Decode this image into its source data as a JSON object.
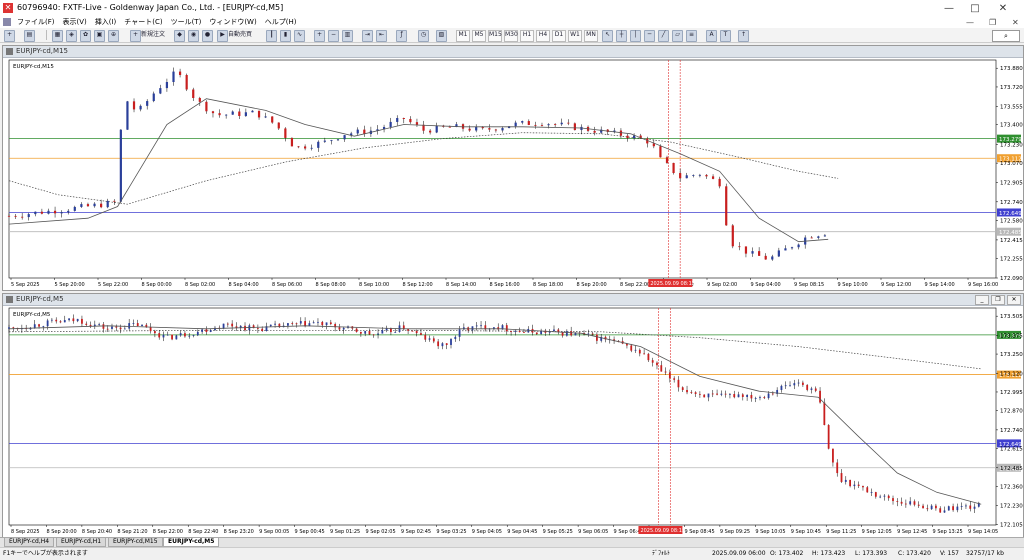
{
  "window": {
    "title": "60796940: FXTF-Live - Goldenway Japan Co., Ltd. - [EURJPY-cd,M5]",
    "icon": "metatrader-icon",
    "controls": [
      "—",
      "□",
      "✕"
    ]
  },
  "menu": {
    "items": [
      "ファイル(F)",
      "表示(V)",
      "挿入(I)",
      "チャート(C)",
      "ツール(T)",
      "ウィンドウ(W)",
      "ヘルプ(H)"
    ],
    "right_controls": [
      "—",
      "❐",
      "✕"
    ]
  },
  "toolbar": {
    "new_order": "新規注文",
    "auto_trade": "自動売買",
    "timeframes": [
      "M1",
      "M5",
      "M15",
      "M30",
      "H1",
      "H4",
      "D1",
      "W1",
      "MN"
    ],
    "search_icon": "magnifier-icon"
  },
  "colors": {
    "green_line": "#2f8f2f",
    "orange_line": "#f0a030",
    "blue_line": "#4040d0",
    "gray_line": "#b8b8b8",
    "red_vline": "#e03030",
    "bull": "#2a3f9a",
    "bear": "#c81e1e",
    "ma": "#555555"
  },
  "chart_top": {
    "window_title": "EURJPY-cd,M15",
    "symbol_label": "EURJPY-cd,M15",
    "price_labels": [
      "173.880",
      "173.720",
      "173.555",
      "173.400",
      "173.230",
      "173.070",
      "172.905",
      "172.740",
      "172.580",
      "172.415",
      "172.255",
      "172.090"
    ],
    "price_min": 172.09,
    "price_max": 173.95,
    "hlines": [
      {
        "price": 173.279,
        "label": "173.279",
        "color": "#2f8f2f"
      },
      {
        "price": 173.112,
        "label": "173.112",
        "color": "#f0a030"
      },
      {
        "price": 172.649,
        "label": "172.649",
        "color": "#4040d0"
      },
      {
        "price": 172.485,
        "label": "172.485",
        "color": "#b8b8b8"
      }
    ],
    "time_labels": [
      "5 Sep 2025",
      "5 Sep 20:00",
      "5 Sep 22:00",
      "8 Sep 00:00",
      "8 Sep 02:00",
      "8 Sep 04:00",
      "8 Sep 06:00",
      "8 Sep 08:00",
      "8 Sep 10:00",
      "8 Sep 12:00",
      "8 Sep 14:00",
      "8 Sep 16:00",
      "8 Sep 18:00",
      "8 Sep 20:00",
      "8 Sep 22:00",
      "9 Sep 00:00",
      "9 Sep 02:00",
      "9 Sep 04:00",
      "9 Sep 08:15",
      "9 Sep 10:00",
      "9 Sep 12:00",
      "9 Sep 14:00",
      "9 Sep 16:00"
    ],
    "cursor_time": "2025.09.09 08:15"
  },
  "chart_bottom": {
    "window_title": "EURJPY-cd,M5",
    "symbol_label": "EURJPY-cd,M5",
    "price_labels": [
      "173.505",
      "173.375",
      "173.250",
      "173.120",
      "172.995",
      "172.870",
      "172.740",
      "172.615",
      "172.485",
      "172.360",
      "172.230",
      "172.105"
    ],
    "price_min": 172.1,
    "price_max": 173.56,
    "hlines": [
      {
        "price": 173.379,
        "label": "173.379",
        "color": "#2f8f2f"
      },
      {
        "price": 173.112,
        "label": "173.112",
        "color": "#f0a030"
      },
      {
        "price": 172.649,
        "label": "172.649",
        "color": "#4040d0"
      },
      {
        "price": 172.485,
        "label": "172.485",
        "color": "#b8b8b8"
      }
    ],
    "time_labels": [
      "8 Sep 2025",
      "8 Sep 20:00",
      "8 Sep 20:40",
      "8 Sep 21:20",
      "8 Sep 22:00",
      "8 Sep 22:40",
      "8 Sep 23:20",
      "9 Sep 00:05",
      "9 Sep 00:45",
      "9 Sep 01:25",
      "9 Sep 02:05",
      "9 Sep 02:45",
      "9 Sep 03:25",
      "9 Sep 04:05",
      "9 Sep 04:45",
      "9 Sep 05:25",
      "9 Sep 06:05",
      "9 Sep 06:45",
      "9 Sep 08:05",
      "9 Sep 08:45",
      "9 Sep 09:25",
      "9 Sep 10:05",
      "9 Sep 10:45",
      "9 Sep 11:25",
      "9 Sep 12:05",
      "9 Sep 12:45",
      "9 Sep 13:25",
      "9 Sep 14:05"
    ],
    "cursor_time": "2025.09.09 08:15"
  },
  "chart_data": [
    {
      "type": "candlestick",
      "symbol": "EURJPY-cd",
      "timeframe": "M15",
      "ylim": [
        172.09,
        173.95
      ],
      "close_path": [
        [
          0,
          172.62
        ],
        [
          0.04,
          172.66
        ],
        [
          0.08,
          172.7
        ],
        [
          0.11,
          172.74
        ],
        [
          0.115,
          173.65
        ],
        [
          0.13,
          173.5
        ],
        [
          0.15,
          173.7
        ],
        [
          0.17,
          173.85
        ],
        [
          0.19,
          173.6
        ],
        [
          0.21,
          173.48
        ],
        [
          0.25,
          173.5
        ],
        [
          0.27,
          173.4
        ],
        [
          0.29,
          173.2
        ],
        [
          0.32,
          173.25
        ],
        [
          0.34,
          173.32
        ],
        [
          0.37,
          173.35
        ],
        [
          0.4,
          173.45
        ],
        [
          0.42,
          173.35
        ],
        [
          0.45,
          173.38
        ],
        [
          0.48,
          173.35
        ],
        [
          0.51,
          173.4
        ],
        [
          0.54,
          173.42
        ],
        [
          0.57,
          173.38
        ],
        [
          0.6,
          173.34
        ],
        [
          0.63,
          173.3
        ],
        [
          0.65,
          173.25
        ],
        [
          0.66,
          173.1
        ],
        [
          0.68,
          172.95
        ],
        [
          0.7,
          172.98
        ],
        [
          0.72,
          172.9
        ],
        [
          0.73,
          172.4
        ],
        [
          0.75,
          172.3
        ],
        [
          0.77,
          172.25
        ],
        [
          0.79,
          172.35
        ],
        [
          0.81,
          172.45
        ],
        [
          0.83,
          172.48
        ]
      ],
      "ma_fast": [
        [
          0,
          172.55
        ],
        [
          0.08,
          172.6
        ],
        [
          0.11,
          172.7
        ],
        [
          0.16,
          173.4
        ],
        [
          0.2,
          173.62
        ],
        [
          0.26,
          173.52
        ],
        [
          0.3,
          173.4
        ],
        [
          0.35,
          173.3
        ],
        [
          0.4,
          173.4
        ],
        [
          0.46,
          173.38
        ],
        [
          0.52,
          173.38
        ],
        [
          0.58,
          173.37
        ],
        [
          0.63,
          173.32
        ],
        [
          0.68,
          173.15
        ],
        [
          0.72,
          173.0
        ],
        [
          0.76,
          172.6
        ],
        [
          0.8,
          172.4
        ],
        [
          0.83,
          172.42
        ]
      ],
      "ma_slow": [
        [
          0,
          172.92
        ],
        [
          0.05,
          172.8
        ],
        [
          0.12,
          172.72
        ],
        [
          0.2,
          172.92
        ],
        [
          0.28,
          173.08
        ],
        [
          0.36,
          173.2
        ],
        [
          0.44,
          173.28
        ],
        [
          0.52,
          173.33
        ],
        [
          0.6,
          173.32
        ],
        [
          0.67,
          173.25
        ],
        [
          0.74,
          173.12
        ],
        [
          0.8,
          173.0
        ],
        [
          0.84,
          172.94
        ]
      ]
    },
    {
      "type": "candlestick",
      "symbol": "EURJPY-cd",
      "timeframe": "M5",
      "ylim": [
        172.1,
        173.56
      ],
      "close_path": [
        [
          0,
          173.42
        ],
        [
          0.04,
          173.46
        ],
        [
          0.07,
          173.48
        ],
        [
          0.1,
          173.42
        ],
        [
          0.13,
          173.45
        ],
        [
          0.16,
          173.36
        ],
        [
          0.19,
          173.4
        ],
        [
          0.22,
          173.45
        ],
        [
          0.25,
          173.42
        ],
        [
          0.28,
          173.44
        ],
        [
          0.31,
          173.46
        ],
        [
          0.34,
          173.42
        ],
        [
          0.37,
          173.38
        ],
        [
          0.4,
          173.43
        ],
        [
          0.42,
          173.36
        ],
        [
          0.44,
          173.3
        ],
        [
          0.46,
          173.42
        ],
        [
          0.49,
          173.44
        ],
        [
          0.52,
          173.4
        ],
        [
          0.55,
          173.4
        ],
        [
          0.58,
          173.38
        ],
        [
          0.61,
          173.34
        ],
        [
          0.64,
          173.26
        ],
        [
          0.66,
          173.14
        ],
        [
          0.68,
          173.02
        ],
        [
          0.7,
          172.98
        ],
        [
          0.72,
          172.96
        ],
        [
          0.74,
          172.98
        ],
        [
          0.76,
          172.96
        ],
        [
          0.78,
          173.02
        ],
        [
          0.8,
          173.06
        ],
        [
          0.82,
          172.98
        ],
        [
          0.83,
          172.62
        ],
        [
          0.84,
          172.42
        ],
        [
          0.86,
          172.36
        ],
        [
          0.88,
          172.3
        ],
        [
          0.9,
          172.26
        ],
        [
          0.92,
          172.24
        ],
        [
          0.94,
          172.2
        ],
        [
          0.96,
          172.22
        ],
        [
          0.985,
          172.23
        ]
      ],
      "ma_fast": [
        [
          0,
          173.42
        ],
        [
          0.1,
          173.44
        ],
        [
          0.2,
          173.42
        ],
        [
          0.3,
          173.44
        ],
        [
          0.4,
          173.42
        ],
        [
          0.5,
          173.42
        ],
        [
          0.58,
          173.39
        ],
        [
          0.64,
          173.3
        ],
        [
          0.7,
          173.1
        ],
        [
          0.76,
          173.0
        ],
        [
          0.82,
          172.96
        ],
        [
          0.86,
          172.7
        ],
        [
          0.9,
          172.45
        ],
        [
          0.94,
          172.32
        ],
        [
          0.985,
          172.24
        ]
      ],
      "ma_slow": [
        [
          0,
          173.4
        ],
        [
          0.2,
          173.41
        ],
        [
          0.4,
          173.41
        ],
        [
          0.6,
          173.4
        ],
        [
          0.7,
          173.36
        ],
        [
          0.8,
          173.3
        ],
        [
          0.9,
          173.22
        ],
        [
          0.985,
          173.15
        ]
      ]
    }
  ],
  "tabs": [
    "EURJPY-cd,H4",
    "EURJPY-cd,H1",
    "EURJPY-cd,M15",
    "EURJPY-cd,M5"
  ],
  "active_tab": 3,
  "status": {
    "help": "F1キーでヘルプが表示されます",
    "profile": "ﾃﾞﾌｫﾙﾄ",
    "datetime": "2025.09.09 06:00",
    "open": "O: 173.402",
    "high": "H: 173.423",
    "low": "L: 173.393",
    "close": "C: 173.420",
    "volume": "V: 157",
    "traffic": "32757/17 kb"
  }
}
